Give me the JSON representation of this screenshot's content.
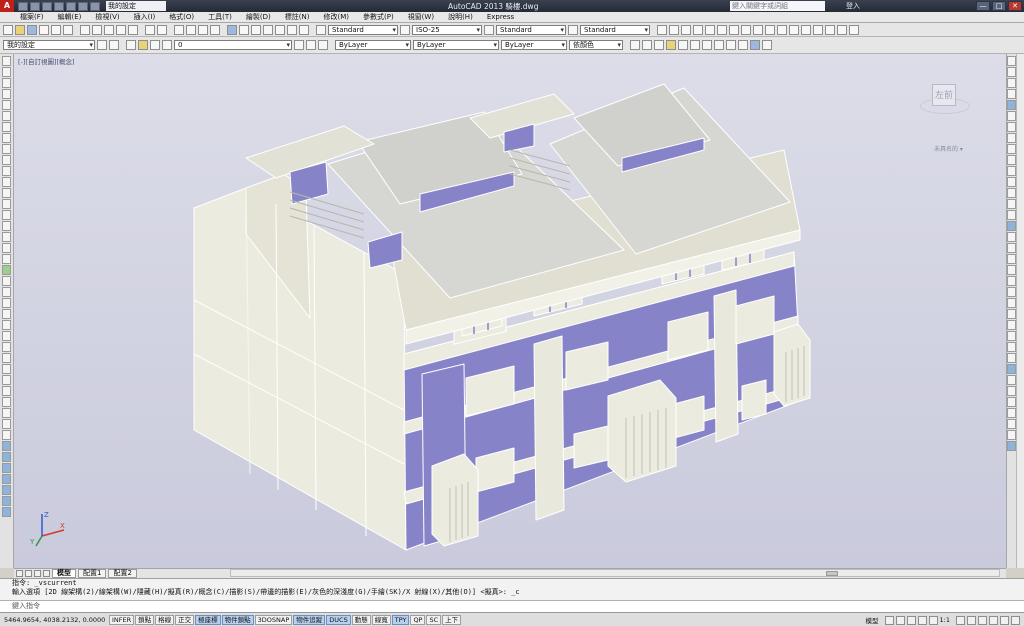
{
  "titlebar": {
    "logo": "A",
    "workspace": "我的設定",
    "title": "AutoCAD 2013   騎樓.dwg",
    "search_placeholder": "鍵入關鍵字或詞組",
    "login": "登入",
    "close": "✕",
    "minimize": "—",
    "maximize": "□"
  },
  "menu": {
    "items": [
      "檔案(F)",
      "編輯(E)",
      "檢視(V)",
      "插入(I)",
      "格式(O)",
      "工具(T)",
      "繪製(D)",
      "標註(N)",
      "修改(M)",
      "參數式(P)",
      "視窗(W)",
      "說明(H)",
      "Express"
    ]
  },
  "toolbar1": {
    "text_style": "Standard",
    "dim_style": "ISO-25",
    "table_style": "Standard",
    "mleader_style": "Standard"
  },
  "toolbar2": {
    "workspace": "我的設定",
    "layer": "0",
    "color": "ByLayer",
    "linetype": "ByLayer",
    "lineweight": "ByLayer",
    "plotstyle": "依顏色"
  },
  "viewport": {
    "label": "[-][自訂視圖][概念]",
    "viewcube_face_left": "左",
    "viewcube_face_front": "前",
    "wcs": "未具名的 ▾"
  },
  "layout": {
    "tabs": [
      "模型",
      "配置1",
      "配置2"
    ],
    "active": "模型"
  },
  "command": {
    "line1": "指令: _vscurrent",
    "line2": "輸入選項 [2D 線架構(2)/線架構(W)/隱藏(H)/擬真(R)/概念(C)/描影(S)/帶邊的描影(E)/灰色的深淺度(G)/手繪(SK)/X 射線(X)/其他(O)] <擬真>: _c",
    "prompt": "鍵入指令"
  },
  "status": {
    "coords": "5464.9654, 4038.2132, 0.0000",
    "toggles": [
      {
        "label": "INFER",
        "on": false
      },
      {
        "label": "鎖點",
        "on": false
      },
      {
        "label": "格線",
        "on": false
      },
      {
        "label": "正交",
        "on": false
      },
      {
        "label": "極座標",
        "on": true
      },
      {
        "label": "物件鎖點",
        "on": true
      },
      {
        "label": "3DOSNAP",
        "on": false
      },
      {
        "label": "物件追蹤",
        "on": true
      },
      {
        "label": "DUCS",
        "on": true
      },
      {
        "label": "動態",
        "on": false
      },
      {
        "label": "線寬",
        "on": false
      },
      {
        "label": "TPY",
        "on": true
      },
      {
        "label": "QP",
        "on": false
      },
      {
        "label": "SC",
        "on": false
      },
      {
        "label": "上下",
        "on": false
      }
    ],
    "model": "模型",
    "annoscale": "1:1"
  },
  "colors": {
    "facade_purple": "#8783c9",
    "wall_cream": "#ecebe0",
    "roof_gray": "#d6d6d2",
    "edge_white": "#ffffff",
    "background_top": "#dcdde8",
    "background_bottom": "#c9cadc"
  }
}
